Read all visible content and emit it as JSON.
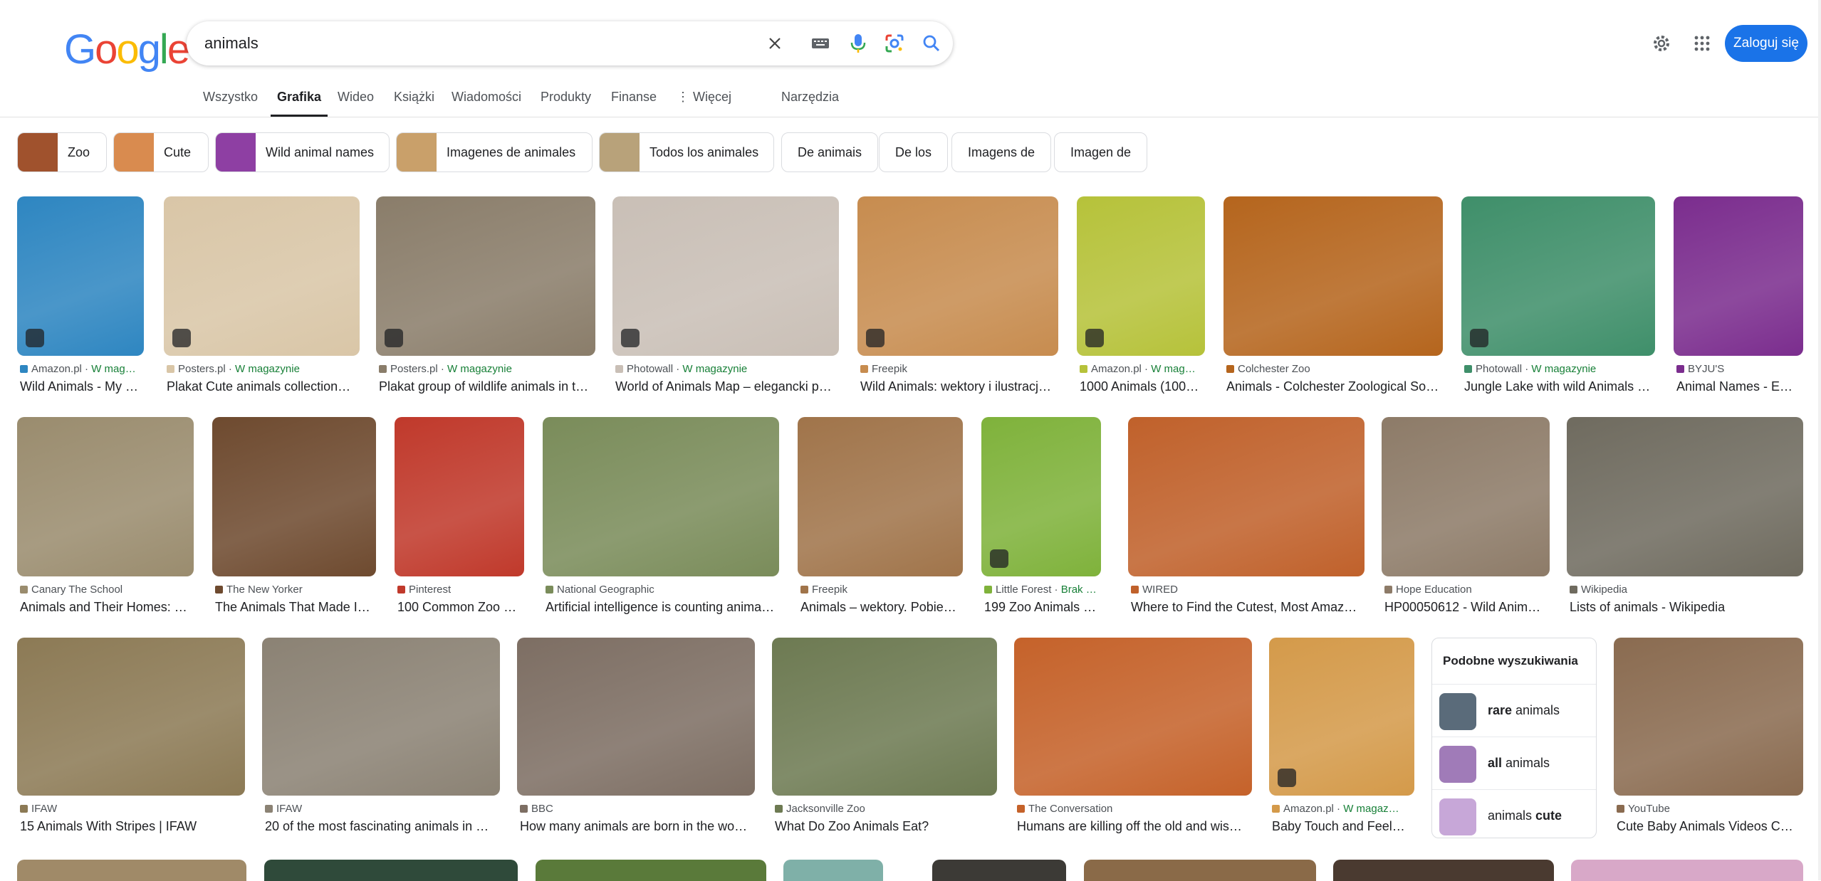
{
  "logo": {
    "g1": "G",
    "o1": "o",
    "o2": "o",
    "g2": "g",
    "l": "l",
    "e": "e"
  },
  "search": {
    "query": "animals"
  },
  "header": {
    "login_label": "Zaloguj się"
  },
  "tabs": [
    {
      "label": "Wszystko"
    },
    {
      "label": "Grafika"
    },
    {
      "label": "Wideo"
    },
    {
      "label": "Książki"
    },
    {
      "label": "Wiadomości"
    },
    {
      "label": "Produkty"
    },
    {
      "label": "Finanse"
    },
    {
      "label": "⋮ Więcej"
    },
    {
      "label": "Narzędzia"
    }
  ],
  "chips": [
    {
      "label": "Zoo"
    },
    {
      "label": "Cute"
    },
    {
      "label": "Wild animal names"
    },
    {
      "label": "Imagenes de animales"
    },
    {
      "label": "Todos los animales"
    },
    {
      "label": "De animais"
    },
    {
      "label": "De los"
    },
    {
      "label": "Imagens de"
    },
    {
      "label": "Imagen de"
    }
  ],
  "results": [
    {
      "source": "Amazon.pl",
      "mag": "W mag…",
      "title": "Wild Animals - My …",
      "color": "#2e86c1"
    },
    {
      "source": "Posters.pl",
      "mag": "W magazynie",
      "title": "Plakat Cute animals collection…",
      "color": "#d9c6a7"
    },
    {
      "source": "Posters.pl",
      "mag": "W magazynie",
      "title": "Plakat group of wildlife animals in t…",
      "color": "#8a7d6a"
    },
    {
      "source": "Photowall",
      "mag": "W magazynie",
      "title": "World of Animals Map – elegancki p…",
      "color": "#c9bfb6"
    },
    {
      "source": "Freepik",
      "mag": "",
      "title": "Wild Animals: wektory i ilustracj…",
      "color": "#c78c4f"
    },
    {
      "source": "Amazon.pl",
      "mag": "W mag…",
      "title": "1000 Animals (100…",
      "color": "#b6c23a"
    },
    {
      "source": "Colchester Zoo",
      "mag": "",
      "title": "Animals - Colchester Zoological So…",
      "color": "#b5651d"
    },
    {
      "source": "Photowall",
      "mag": "W magazynie",
      "title": "Jungle Lake with wild Animals …",
      "color": "#3f8f6a"
    },
    {
      "source": "BYJU'S",
      "mag": "",
      "title": "Animal Names - E…",
      "color": "#7b2d8e"
    },
    {
      "source": "Canary The School",
      "mag": "",
      "title": "Animals and Their Homes: …",
      "color": "#9a8c6e"
    },
    {
      "source": "The New Yorker",
      "mag": "",
      "title": "The Animals That Made It…",
      "color": "#6e4a2f"
    },
    {
      "source": "Pinterest",
      "mag": "",
      "title": "100 Common Zoo …",
      "color": "#c0392b"
    },
    {
      "source": "National Geographic",
      "mag": "",
      "title": "Artificial intelligence is counting anima…",
      "color": "#7a8c5a"
    },
    {
      "source": "Freepik",
      "mag": "",
      "title": "Animals – wektory. Pobie…",
      "color": "#a0744a"
    },
    {
      "source": "Little Forest",
      "mag": "Brak …",
      "title": "199 Zoo Animals | …",
      "color": "#7fb23b"
    },
    {
      "source": "WIRED",
      "mag": "",
      "title": "Where to Find the Cutest, Most Amaz…",
      "color": "#c0612b"
    },
    {
      "source": "Hope Education",
      "mag": "",
      "title": "HP00050612 - Wild Anim…",
      "color": "#8d7b68"
    },
    {
      "source": "Wikipedia",
      "mag": "",
      "title": "Lists of animals - Wikipedia",
      "color": "#6f6b5f"
    },
    {
      "source": "IFAW",
      "mag": "",
      "title": "15 Animals With Stripes | IFAW",
      "color": "#8c7a55"
    },
    {
      "source": "IFAW",
      "mag": "",
      "title": "20 of the most fascinating animals in …",
      "color": "#8b8274"
    },
    {
      "source": "BBC",
      "mag": "",
      "title": "How many animals are born in the wo…",
      "color": "#7d6e63"
    },
    {
      "source": "Jacksonville Zoo",
      "mag": "",
      "title": "What Do Zoo Animals Eat?",
      "color": "#6d7a52"
    },
    {
      "source": "The Conversation",
      "mag": "",
      "title": "Humans are killing off the old and wis…",
      "color": "#c5622a"
    },
    {
      "source": "Amazon.pl",
      "mag": "W magaz…",
      "title": "Baby Touch and Feel…",
      "color": "#d49a4a"
    },
    {
      "source": "YouTube",
      "mag": "",
      "title": "Cute Baby Animals Videos C…",
      "color": "#8a6b50"
    }
  ],
  "related": {
    "title": "Podobne wyszukiwania",
    "items": [
      {
        "bold": "rare",
        "rest": " animals"
      },
      {
        "bold": "all",
        "rest": " animals"
      },
      {
        "rest": "animals ",
        "bold": "cute"
      }
    ]
  }
}
